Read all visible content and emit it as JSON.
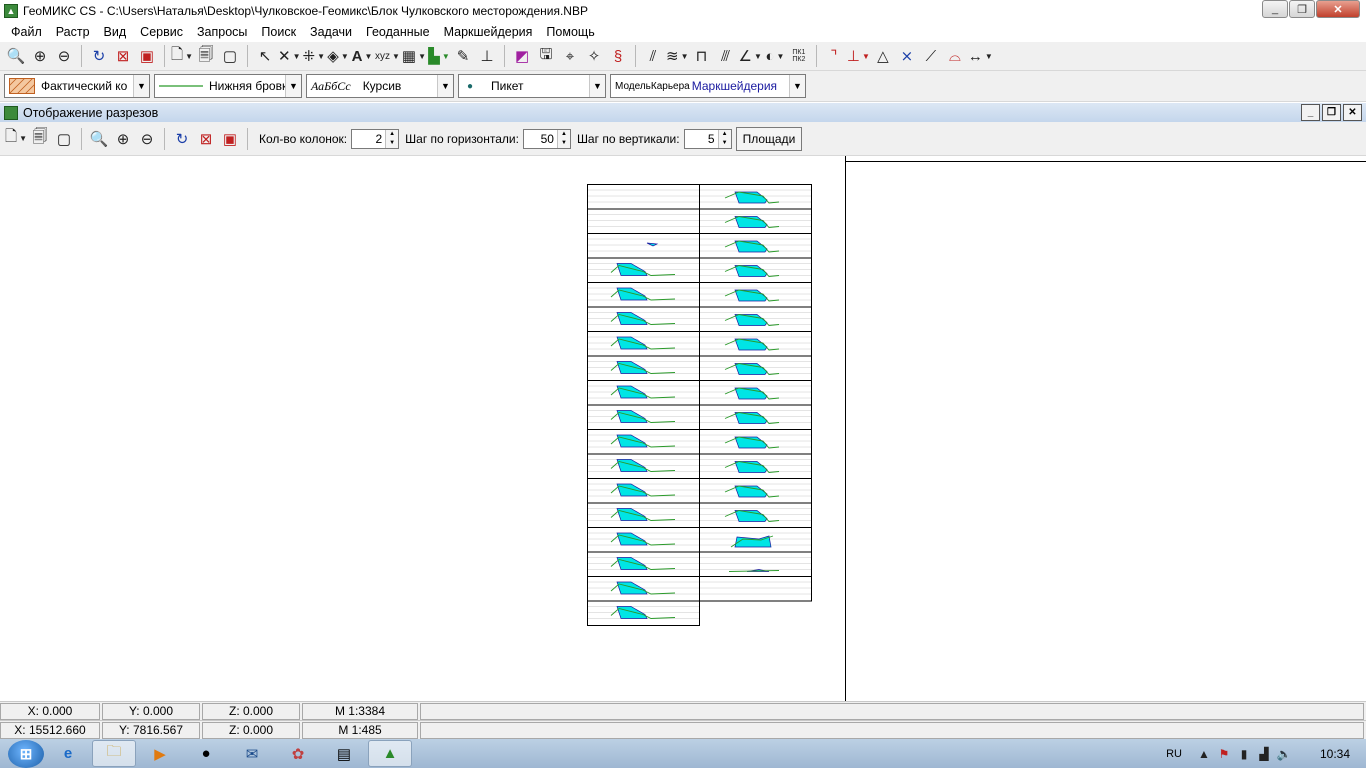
{
  "window": {
    "title": "ГеоМИКС CS - C:\\Users\\Наталья\\Desktop\\Чулковское-Геомикс\\Блок Чулковского месторождения.NBP"
  },
  "menu": [
    "Файл",
    "Растр",
    "Вид",
    "Сервис",
    "Запросы",
    "Поиск",
    "Задачи",
    "Геоданные",
    "Маркшейдерия",
    "Помощь"
  ],
  "style_bar": {
    "fill_label": "Фактический ко",
    "line_label": "Нижняя бровк",
    "font_sample": "АаБбСс",
    "font_label": "Курсив",
    "point_label": "Пикет",
    "model_prefix": "МодельКарьера",
    "model_label": "Маркшейдерия"
  },
  "document": {
    "title": "Отображение разрезов",
    "columns_label": "Кол-во колонок:",
    "columns_value": "2",
    "hstep_label": "Шаг по горизонтали:",
    "hstep_value": "50",
    "vstep_label": "Шаг по вертикали:",
    "vstep_value": "5",
    "areas_button": "Площади"
  },
  "section_colors": {
    "fill": "#00e5e5",
    "line": "#2a9a2a",
    "edge": "#1a1aa0"
  },
  "status": {
    "row1": {
      "x": "X: 0.000",
      "y": "Y: 0.000",
      "z": "Z: 0.000",
      "m": "M 1:3384"
    },
    "row2": {
      "x": "X: 15512.660",
      "y": "Y: 7816.567",
      "z": "Z: 0.000",
      "m": "M 1:485"
    }
  },
  "taskbar": {
    "lang": "RU",
    "clock": "10:34"
  }
}
